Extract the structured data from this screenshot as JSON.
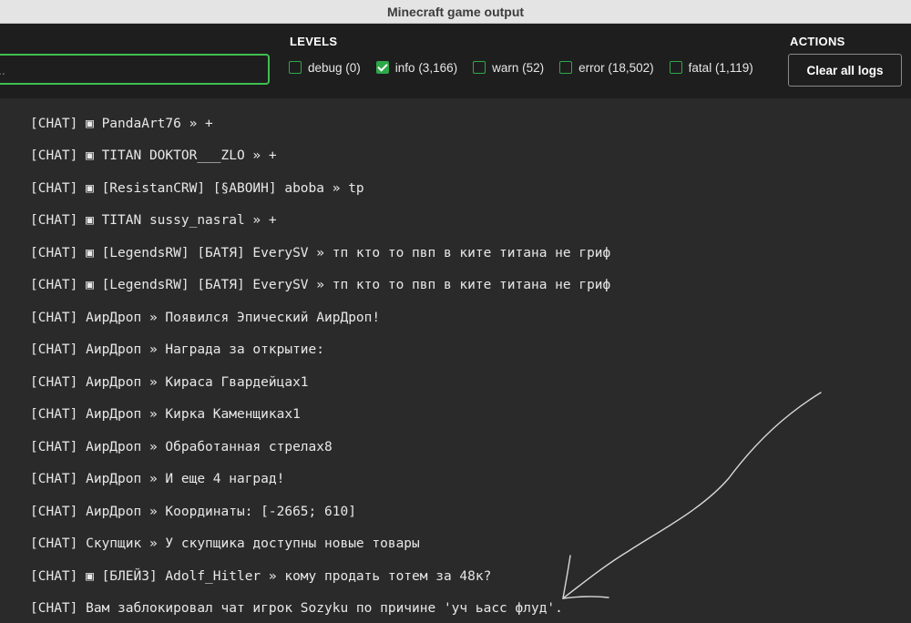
{
  "window": {
    "title": "Minecraft game output"
  },
  "search": {
    "value": ".."
  },
  "levels": {
    "title": "LEVELS",
    "items": [
      {
        "label": "debug (0)",
        "checked": false
      },
      {
        "label": "info (3,166)",
        "checked": true
      },
      {
        "label": "warn (52)",
        "checked": false
      },
      {
        "label": "error (18,502)",
        "checked": false
      },
      {
        "label": "fatal (1,119)",
        "checked": false
      }
    ]
  },
  "actions": {
    "title": "ACTIONS",
    "clear_label": "Clear all logs"
  },
  "colors": {
    "accent": "#2fa84a",
    "search_border": "#3fbf4f",
    "background": "#2a2a2a",
    "toolbar": "#1e1e1e"
  },
  "logs": [
    "[CHAT] ▣ PandaArt76 » +",
    "[CHAT] ▣ TITAN DOKTOR___ZLO » +",
    "[CHAT] ▣ [ResistanCRW] [§АВОИН] aboba » tp",
    "[CHAT] ▣ TITAN sussy_nasral » +",
    "[CHAT] ▣ [LegendsRW] [БАТЯ] EverySV » тп кто то пвп в ките титана не гриф",
    "[CHAT] ▣ [LegendsRW] [БАТЯ] EverySV » тп кто то пвп в ките титана не гриф",
    "[CHAT] АирДроп » Появился Эпический АирДроп!",
    "[CHAT] АирДроп » Награда за открытие:",
    "[CHAT] АирДроп » Кираса Гвардейцах1",
    "[CHAT] АирДроп » Кирка Каменщиках1",
    "[CHAT] АирДроп » Обработанная стрелах8",
    "[CHAT] АирДроп » И еще 4 наград!",
    "[CHAT] АирДроп » Координаты: [-2665; 610]",
    "[CHAT] Скупщик » У скупщика доступны новые товары",
    "[CHAT] ▣ [БЛЕЙЗ] Adolf_Hitler » кому продать тотем за 48к?",
    "[CHAT] Вам заблокировал чат игрок Sozyku по причине 'уч ьасс флуд'."
  ]
}
